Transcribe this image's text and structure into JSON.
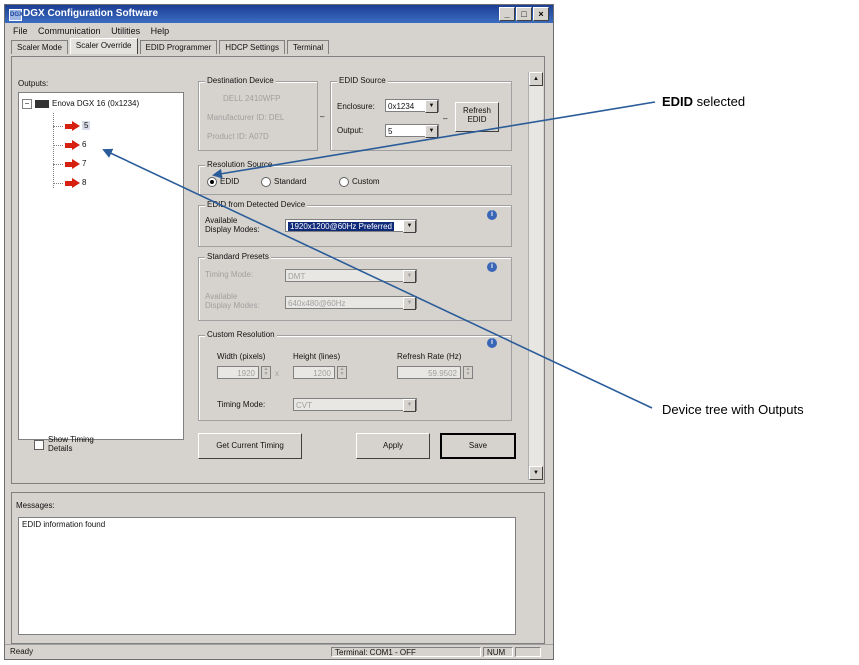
{
  "window": {
    "title": "DGX Configuration Software",
    "minimize": "_",
    "maximize": "□",
    "close": "×"
  },
  "menu": [
    "File",
    "Communication",
    "Utilities",
    "Help"
  ],
  "tabs": [
    "Scaler Mode",
    "Scaler Override",
    "EDID Programmer",
    "HDCP Settings",
    "Terminal"
  ],
  "active_tab": "Scaler Override",
  "outputs": {
    "label": "Outputs:",
    "root": "Enova DGX 16 (0x1234)",
    "children": [
      "5",
      "6",
      "7",
      "8"
    ]
  },
  "show_timing": "Show Timing Details",
  "destination_device": {
    "title": "Destination Device",
    "model": "DELL 2410WFP",
    "manufacturer": "Manufacturer ID: DEL",
    "product": "Product ID: A07D"
  },
  "edid_source": {
    "title": "EDID Source",
    "enclosure_label": "Enclosure:",
    "enclosure_value": "0x1234",
    "output_label": "Output:",
    "output_value": "5",
    "refresh_button": "Refresh EDID"
  },
  "resolution_source": {
    "title": "Resolution Source",
    "options": [
      "EDID",
      "Standard",
      "Custom"
    ],
    "selected": "EDID"
  },
  "edid_detected": {
    "title": "EDID from Detected Device",
    "available_label": "Available Display Modes:",
    "available_value": "1920x1200@60Hz Preferred"
  },
  "standard_presets": {
    "title": "Standard Presets",
    "timing_label": "Timing Mode:",
    "timing_value": "DMT",
    "available_label": "Available Display Modes:",
    "available_value": "640x480@60Hz"
  },
  "custom_resolution": {
    "title": "Custom Resolution",
    "width_label": "Width (pixels)",
    "width_value": "1920",
    "x_sep": "x",
    "height_label": "Height (lines)",
    "height_value": "1200",
    "refresh_label": "Refresh Rate (Hz)",
    "refresh_value": "59.9502",
    "timing_label": "Timing Mode:",
    "timing_value": "CVT"
  },
  "buttons": {
    "get_timing": "Get Current Timing",
    "apply": "Apply",
    "save": "Save"
  },
  "messages": {
    "label": "Messages:",
    "text": "EDID information found"
  },
  "status": {
    "left": "Ready",
    "terminal": "Terminal: COM1 - OFF",
    "num": "NUM"
  },
  "callouts": {
    "edid_bold": "EDID",
    "edid_rest": " selected",
    "tree": "Device tree with Outputs"
  },
  "colors": {
    "titlebar": "#1c3f95",
    "arrow_red": "#d62010",
    "callout_line": "#2a5c9a",
    "info_blue": "#3a66b8"
  }
}
